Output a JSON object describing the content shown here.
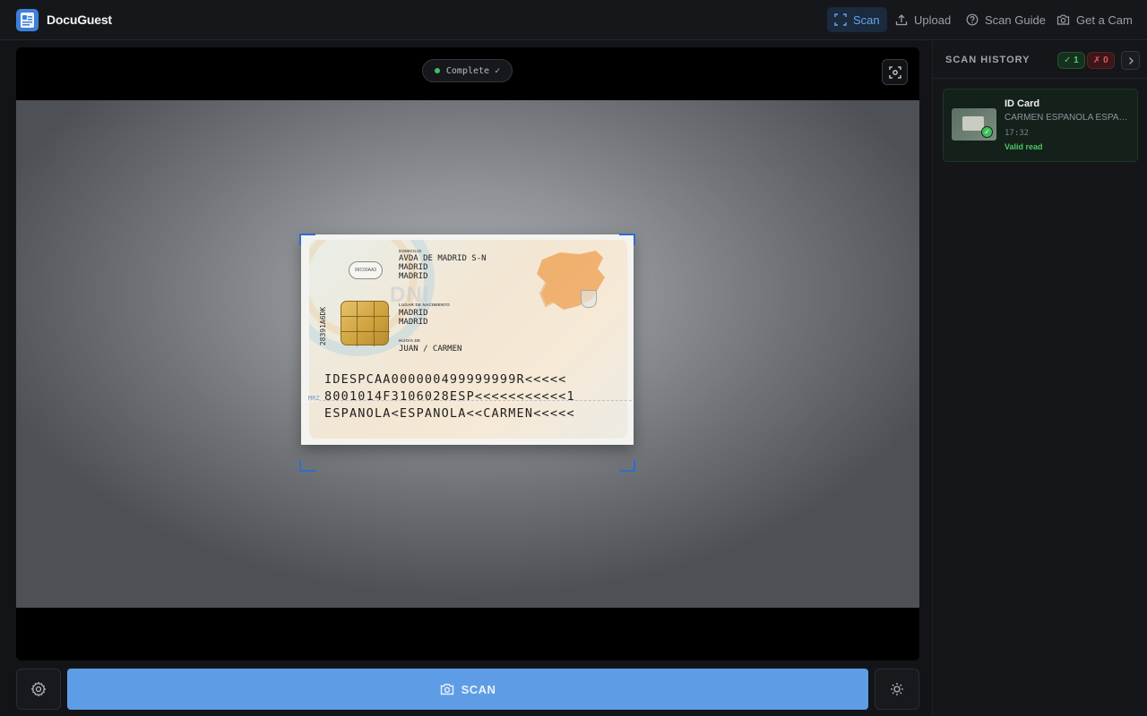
{
  "app": {
    "name": "DocuGuest"
  },
  "nav": {
    "items": [
      {
        "label": "Scan",
        "icon": "scan-frame-icon",
        "active": true
      },
      {
        "label": "Upload",
        "icon": "upload-icon",
        "active": false
      },
      {
        "label": "Scan Guide",
        "icon": "help-circle-icon",
        "active": false
      },
      {
        "label": "Get a Cam",
        "icon": "camera-icon",
        "active": false
      }
    ]
  },
  "camera": {
    "status": "Complete ✓",
    "status_color": "#3fbf5a"
  },
  "document": {
    "domicilio_label": "DOMICILIO",
    "domicilio_lines": "AVDA DE MADRID S-N\nMADRID\nMADRID",
    "lugar_label": "LUGAR DE NACIMIENTO",
    "lugar_lines": "MADRID\nMADRID",
    "padres_label": "HIJO/A DE",
    "padres": "JUAN / CARMEN",
    "equipo": "28391A6DK",
    "stamp": "99C00AA3",
    "watermark": "DNI",
    "mrz_tag": "MRZ",
    "mrz": [
      "IDESPCAA000000499999999R<<<<<",
      "8001014F3106028ESP<<<<<<<<<<<1",
      "ESPANOLA<ESPANOLA<<CARMEN<<<<<"
    ]
  },
  "controls": {
    "scan_label": "SCAN",
    "accent": "#5f9ce6"
  },
  "history": {
    "title": "SCAN HISTORY",
    "success_count": "✓ 1",
    "error_count": "✗ 0",
    "items": [
      {
        "type": "ID Card",
        "name": "CARMEN ESPANOLA ESPANOLA",
        "time": "17:32",
        "status": "Valid read"
      }
    ]
  }
}
